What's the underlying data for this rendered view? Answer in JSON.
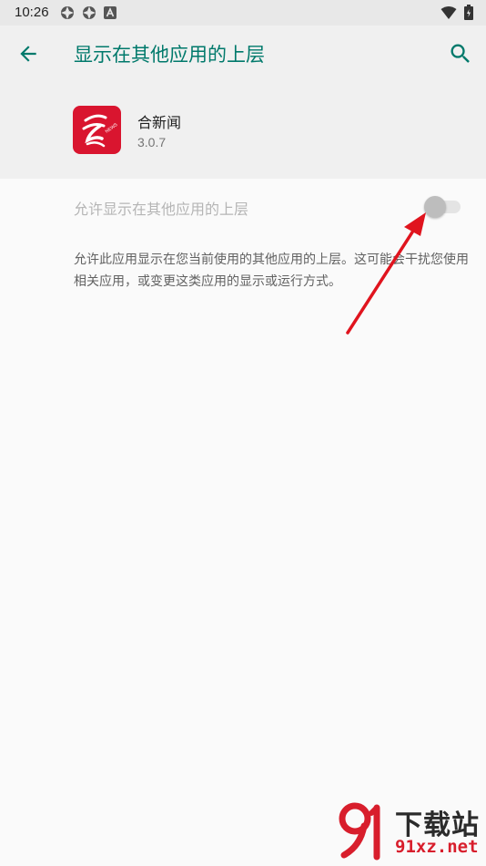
{
  "status_bar": {
    "time": "10:26"
  },
  "toolbar": {
    "title": "显示在其他应用的上层"
  },
  "app": {
    "name": "合新闻",
    "version": "3.0.7"
  },
  "setting": {
    "label": "允许显示在其他应用的上层",
    "enabled": false,
    "description": "允许此应用显示在您当前使用的其他应用的上层。这可能会干扰您使用相关应用，或变更这类应用的显示或运行方式。"
  },
  "watermark": {
    "title": "下载站",
    "domain": "91xz.net"
  },
  "colors": {
    "accent": "#00796b",
    "app_icon": "#d9152f",
    "arrow": "#e0141e"
  }
}
